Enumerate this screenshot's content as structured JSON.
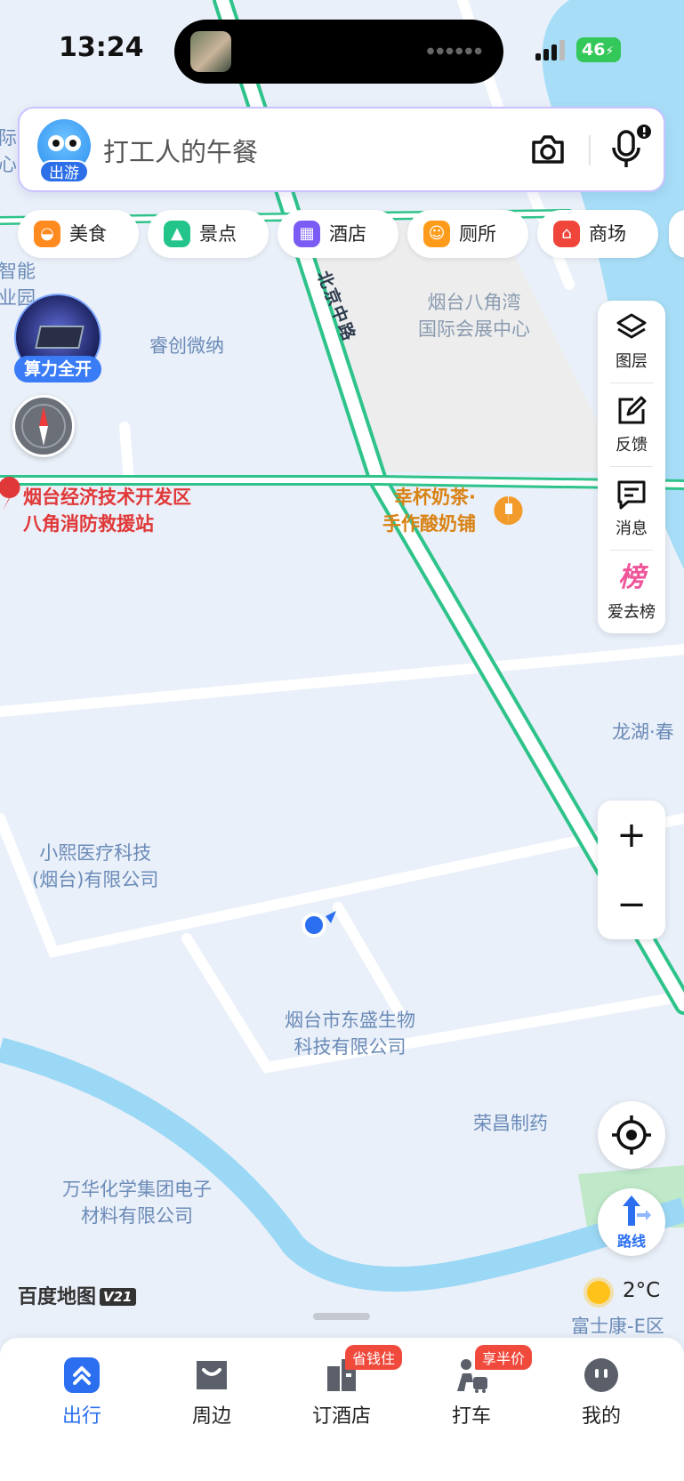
{
  "status_bar": {
    "time": "13:24",
    "battery": "46"
  },
  "search": {
    "placeholder_text": "打工人的午餐",
    "mascot_tag": "出游"
  },
  "categories": [
    {
      "label": "美食",
      "icon": "food-icon",
      "color": "#ff8a1f"
    },
    {
      "label": "景点",
      "icon": "scenic-icon",
      "color": "#22c48a"
    },
    {
      "label": "酒店",
      "icon": "hotel-icon",
      "color": "#7a5cf5"
    },
    {
      "label": "厕所",
      "icon": "toilet-icon",
      "color": "#ff9b1a"
    },
    {
      "label": "商场",
      "icon": "mall-icon",
      "color": "#f0453a"
    }
  ],
  "promo": {
    "label": "算力全开"
  },
  "right_panel": {
    "layers": "图层",
    "feedback": "反馈",
    "messages": "消息",
    "ranking_glyph": "榜",
    "ranking": "爱去榜"
  },
  "zoom": {
    "in": "+",
    "out": "−"
  },
  "route": {
    "label": "路线"
  },
  "map_labels": {
    "expo": "烟台八角湾\n国际会展中心",
    "ruichuang": "睿创微纳",
    "fire_station": "烟台经济技术开发区\n八角消防救援站",
    "milk_tea": "幸杯奶茶·\n手作酸奶铺",
    "longhu": "龙湖·春",
    "xiaoxi": "小熙医疗科技\n(烟台)有限公司",
    "dongsheng": "烟台市东盛生物\n科技有限公司",
    "rongchang": "荣昌制药",
    "wanhua": "万华化学集团电子\n材料有限公司",
    "foxconn": "富士康-E区",
    "road_name": "北京中路",
    "left_edge_1": "际\n心",
    "left_edge_2": "智能\n业园"
  },
  "brand": {
    "name": "百度地图",
    "version": "V21"
  },
  "weather": {
    "temp": "2°C"
  },
  "tabs": [
    {
      "label": "出行",
      "active": true
    },
    {
      "label": "周边"
    },
    {
      "label": "订酒店",
      "badge": "省钱住"
    },
    {
      "label": "打车",
      "badge": "享半价"
    },
    {
      "label": "我的"
    }
  ],
  "colors": {
    "accent": "#2b6ff0",
    "route_green": "#2ec38a",
    "river": "#9bd8f5"
  }
}
